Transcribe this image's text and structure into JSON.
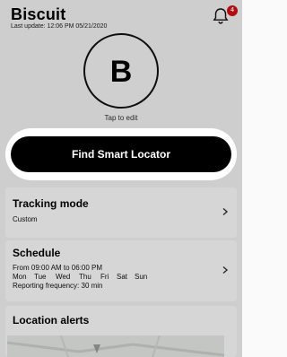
{
  "pet": {
    "name": "Biscuit",
    "last_update": "Last update: 12:06 PM 05/21/2020",
    "initial": "B",
    "tap_to_edit": "Tap to edit"
  },
  "notifications": {
    "count": "4",
    "icon": "bell-icon",
    "badge_color": "#d40f14"
  },
  "cta": {
    "label": "Find Smart Locator"
  },
  "tracking": {
    "title": "Tracking mode",
    "value": "Custom"
  },
  "schedule": {
    "title": "Schedule",
    "hours": "From 09:00 AM to 06:00 PM",
    "days": [
      "Mon",
      "Tue",
      "Wed",
      "Thu",
      "Fri",
      "Sat",
      "Sun"
    ],
    "frequency": "Reporting frequency: 30 min"
  },
  "alerts": {
    "title": "Location alerts"
  },
  "colors": {
    "cta_bg": "#000000",
    "overlay": "rgba(0,0,0,0.16)"
  }
}
